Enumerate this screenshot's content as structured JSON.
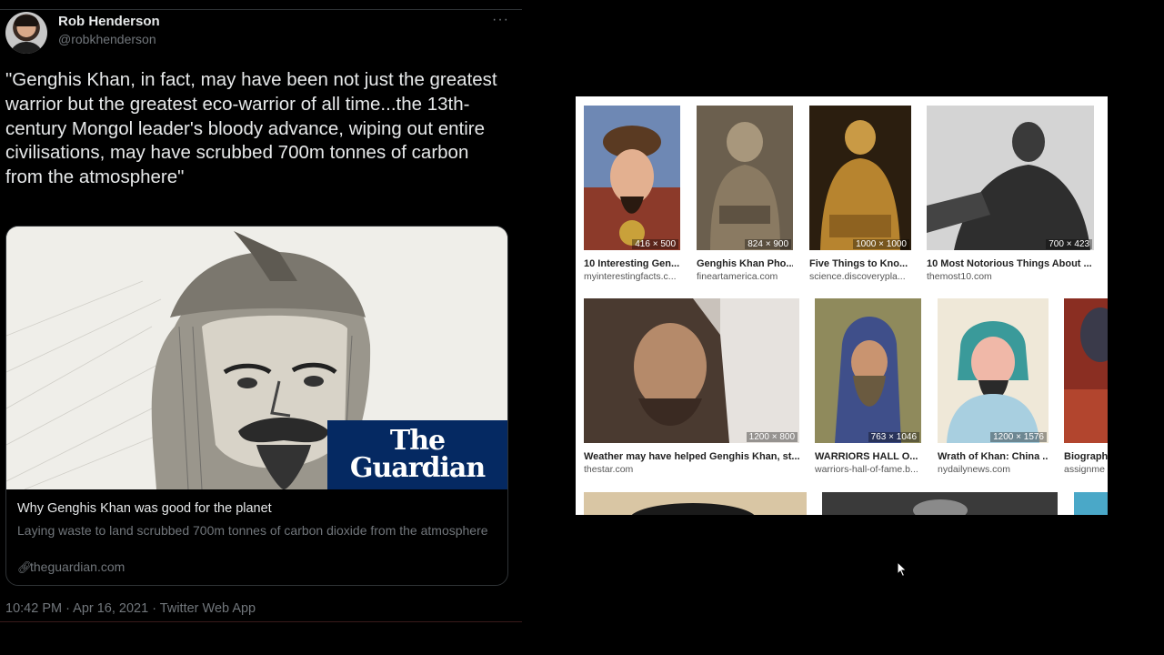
{
  "tweet": {
    "author_name": "Rob Henderson",
    "author_handle": "@robkhenderson",
    "more_icon": "more-horizontal-icon",
    "text": "\"Genghis Khan, in fact, may have been not just the greatest warrior but the greatest eco-warrior of all time...the 13th-century Mongol leader's bloody advance, wiping out entire civilisations, may have scrubbed 700m tonnes of carbon from the atmosphere\"",
    "card": {
      "brand": "The Guardian",
      "title": "Why Genghis Khan was good for the planet",
      "description": "Laying waste to land scrubbed 700m tonnes of carbon dioxide from the atmosphere",
      "domain": "theguardian.com"
    },
    "timestamp": "10:42 PM · Apr 16, 2021 · Twitter Web App"
  },
  "image_results": {
    "row1": [
      {
        "title": "10 Interesting Gen...",
        "source": "myinterestingfacts.c...",
        "dims": "416 × 500"
      },
      {
        "title": "Genghis Khan Pho...",
        "source": "fineartamerica.com",
        "dims": "824 × 900"
      },
      {
        "title": "Five Things to Kno...",
        "source": "science.discoverypla...",
        "dims": "1000 × 1000"
      },
      {
        "title": "10 Most Notorious Things About ...",
        "source": "themost10.com",
        "dims": "700 × 423"
      }
    ],
    "row2": [
      {
        "title": "Weather may have helped Genghis Khan, st...",
        "source": "thestar.com",
        "dims": "1200 × 800"
      },
      {
        "title": "WARRIORS HALL O...",
        "source": "warriors-hall-of-fame.b...",
        "dims": "763 × 1046"
      },
      {
        "title": "Wrath of Khan: China ...",
        "source": "nydailynews.com",
        "dims": "1200 × 1576"
      },
      {
        "title": "Biograph",
        "source": "assignme",
        "dims": ""
      }
    ]
  },
  "cursor": "mouse-pointer-icon"
}
